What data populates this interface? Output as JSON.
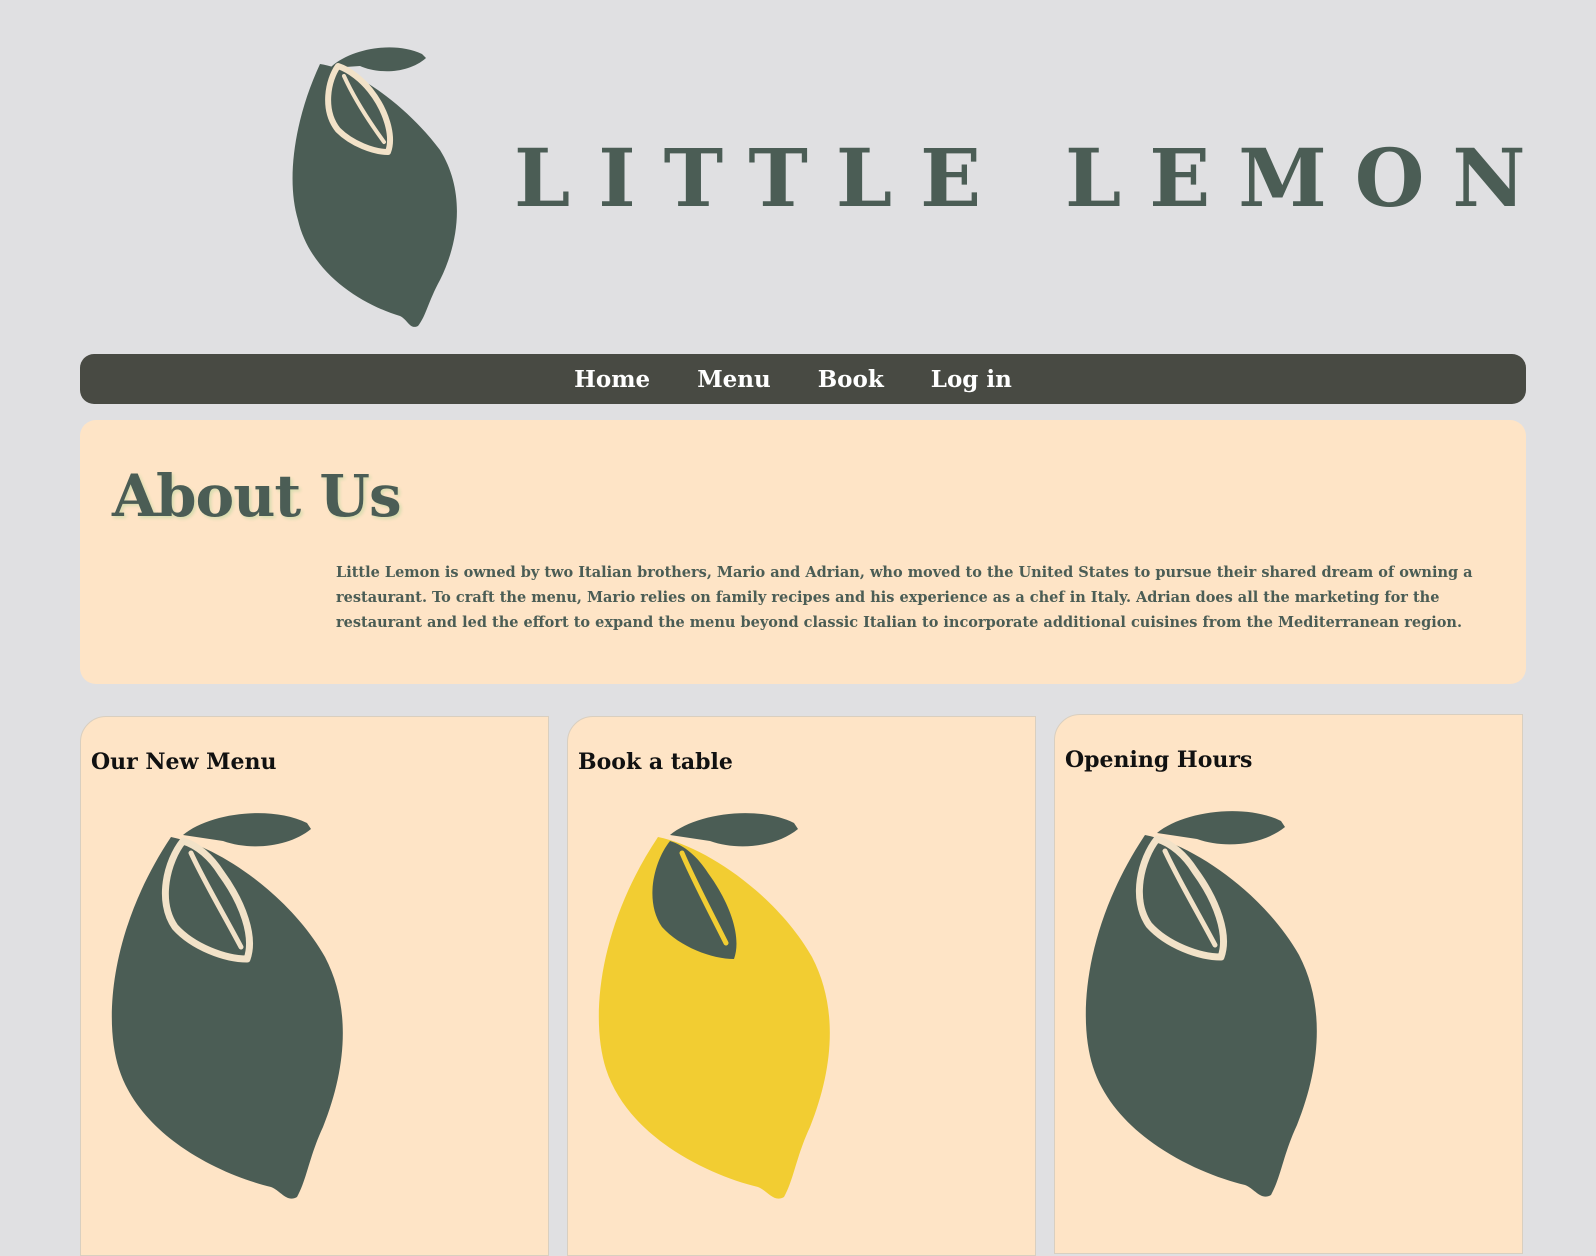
{
  "header": {
    "logo_text": "LITTLE LEMON",
    "logo_icon": "lemon-icon"
  },
  "nav": {
    "items": [
      {
        "label": "Home"
      },
      {
        "label": "Menu"
      },
      {
        "label": "Book"
      },
      {
        "label": "Log in"
      }
    ]
  },
  "about": {
    "title": "About Us",
    "body": "Little Lemon is owned by two Italian brothers, Mario and Adrian, who moved to the United States to pursue their shared dream of owning a restaurant. To craft the menu, Mario relies on family recipes and his experience as a chef in Italy. Adrian does all the marketing for the restaurant and led the effort to expand the menu beyond classic Italian to incorporate additional cuisines from the Mediterranean region."
  },
  "cards": [
    {
      "title": "Our New Menu",
      "icon": "lemon-icon",
      "color": "#4b5d55"
    },
    {
      "title": "Book a table",
      "icon": "lemon-icon",
      "color": "#f2cd32"
    },
    {
      "title": "Opening Hours",
      "icon": "lemon-icon",
      "color": "#4b5d55"
    }
  ],
  "colors": {
    "background": "#e0e0e2",
    "brand_green": "#4b5d55",
    "nav": "#484a43",
    "panel": "#fee4c6",
    "lemon_yellow": "#f2cd32"
  }
}
